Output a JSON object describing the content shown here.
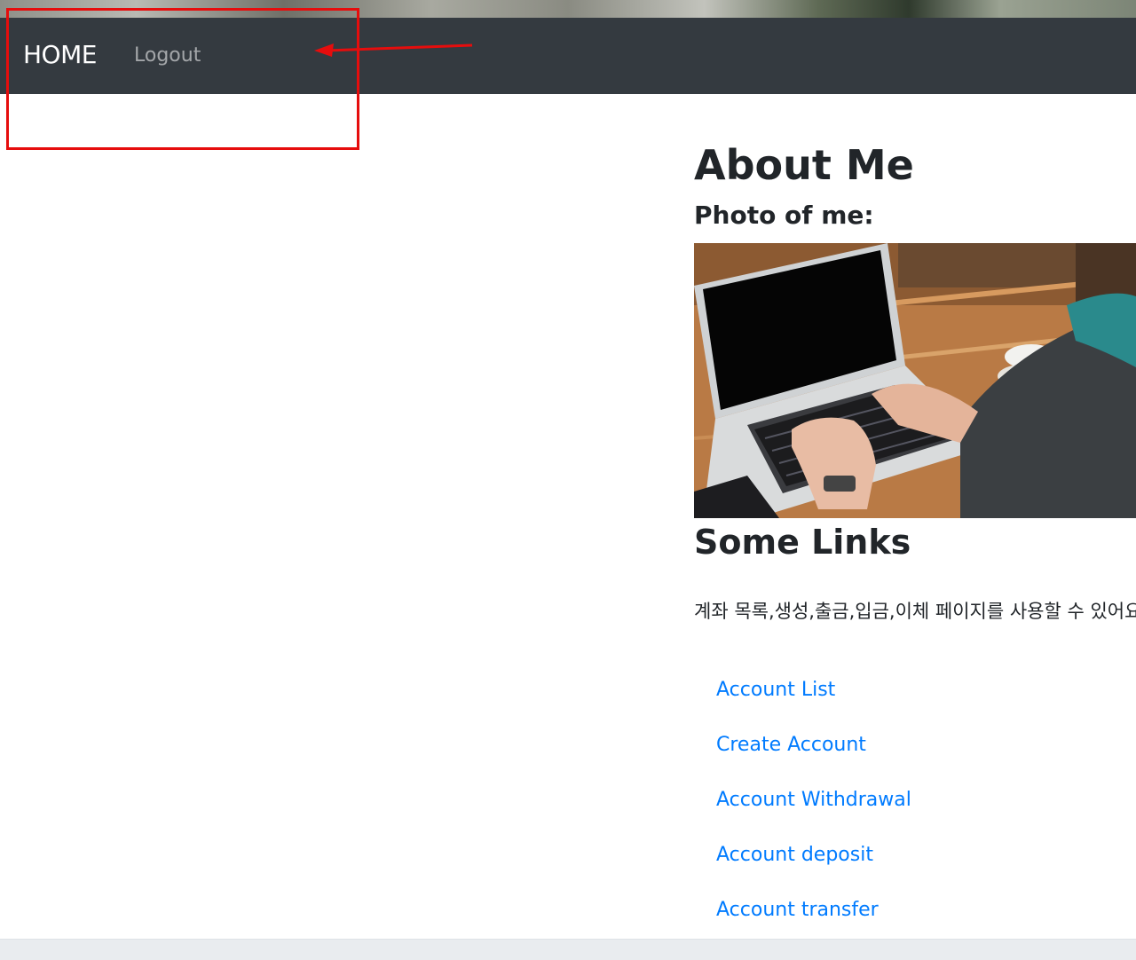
{
  "navbar": {
    "brand": "HOME",
    "logout_label": "Logout"
  },
  "main": {
    "title": "About Me",
    "photo_heading": "Photo of me:",
    "links_heading": "Some Links",
    "description": "계좌 목록,생성,출금,입금,이체 페이지를 사용할 수 있어요",
    "links": [
      {
        "label": "Account List"
      },
      {
        "label": "Create Account"
      },
      {
        "label": "Account Withdrawal"
      },
      {
        "label": "Account deposit"
      },
      {
        "label": "Account transfer"
      }
    ]
  },
  "colors": {
    "navbar_bg": "#343a40",
    "link": "#007bff",
    "annotation": "#e60d0d"
  }
}
